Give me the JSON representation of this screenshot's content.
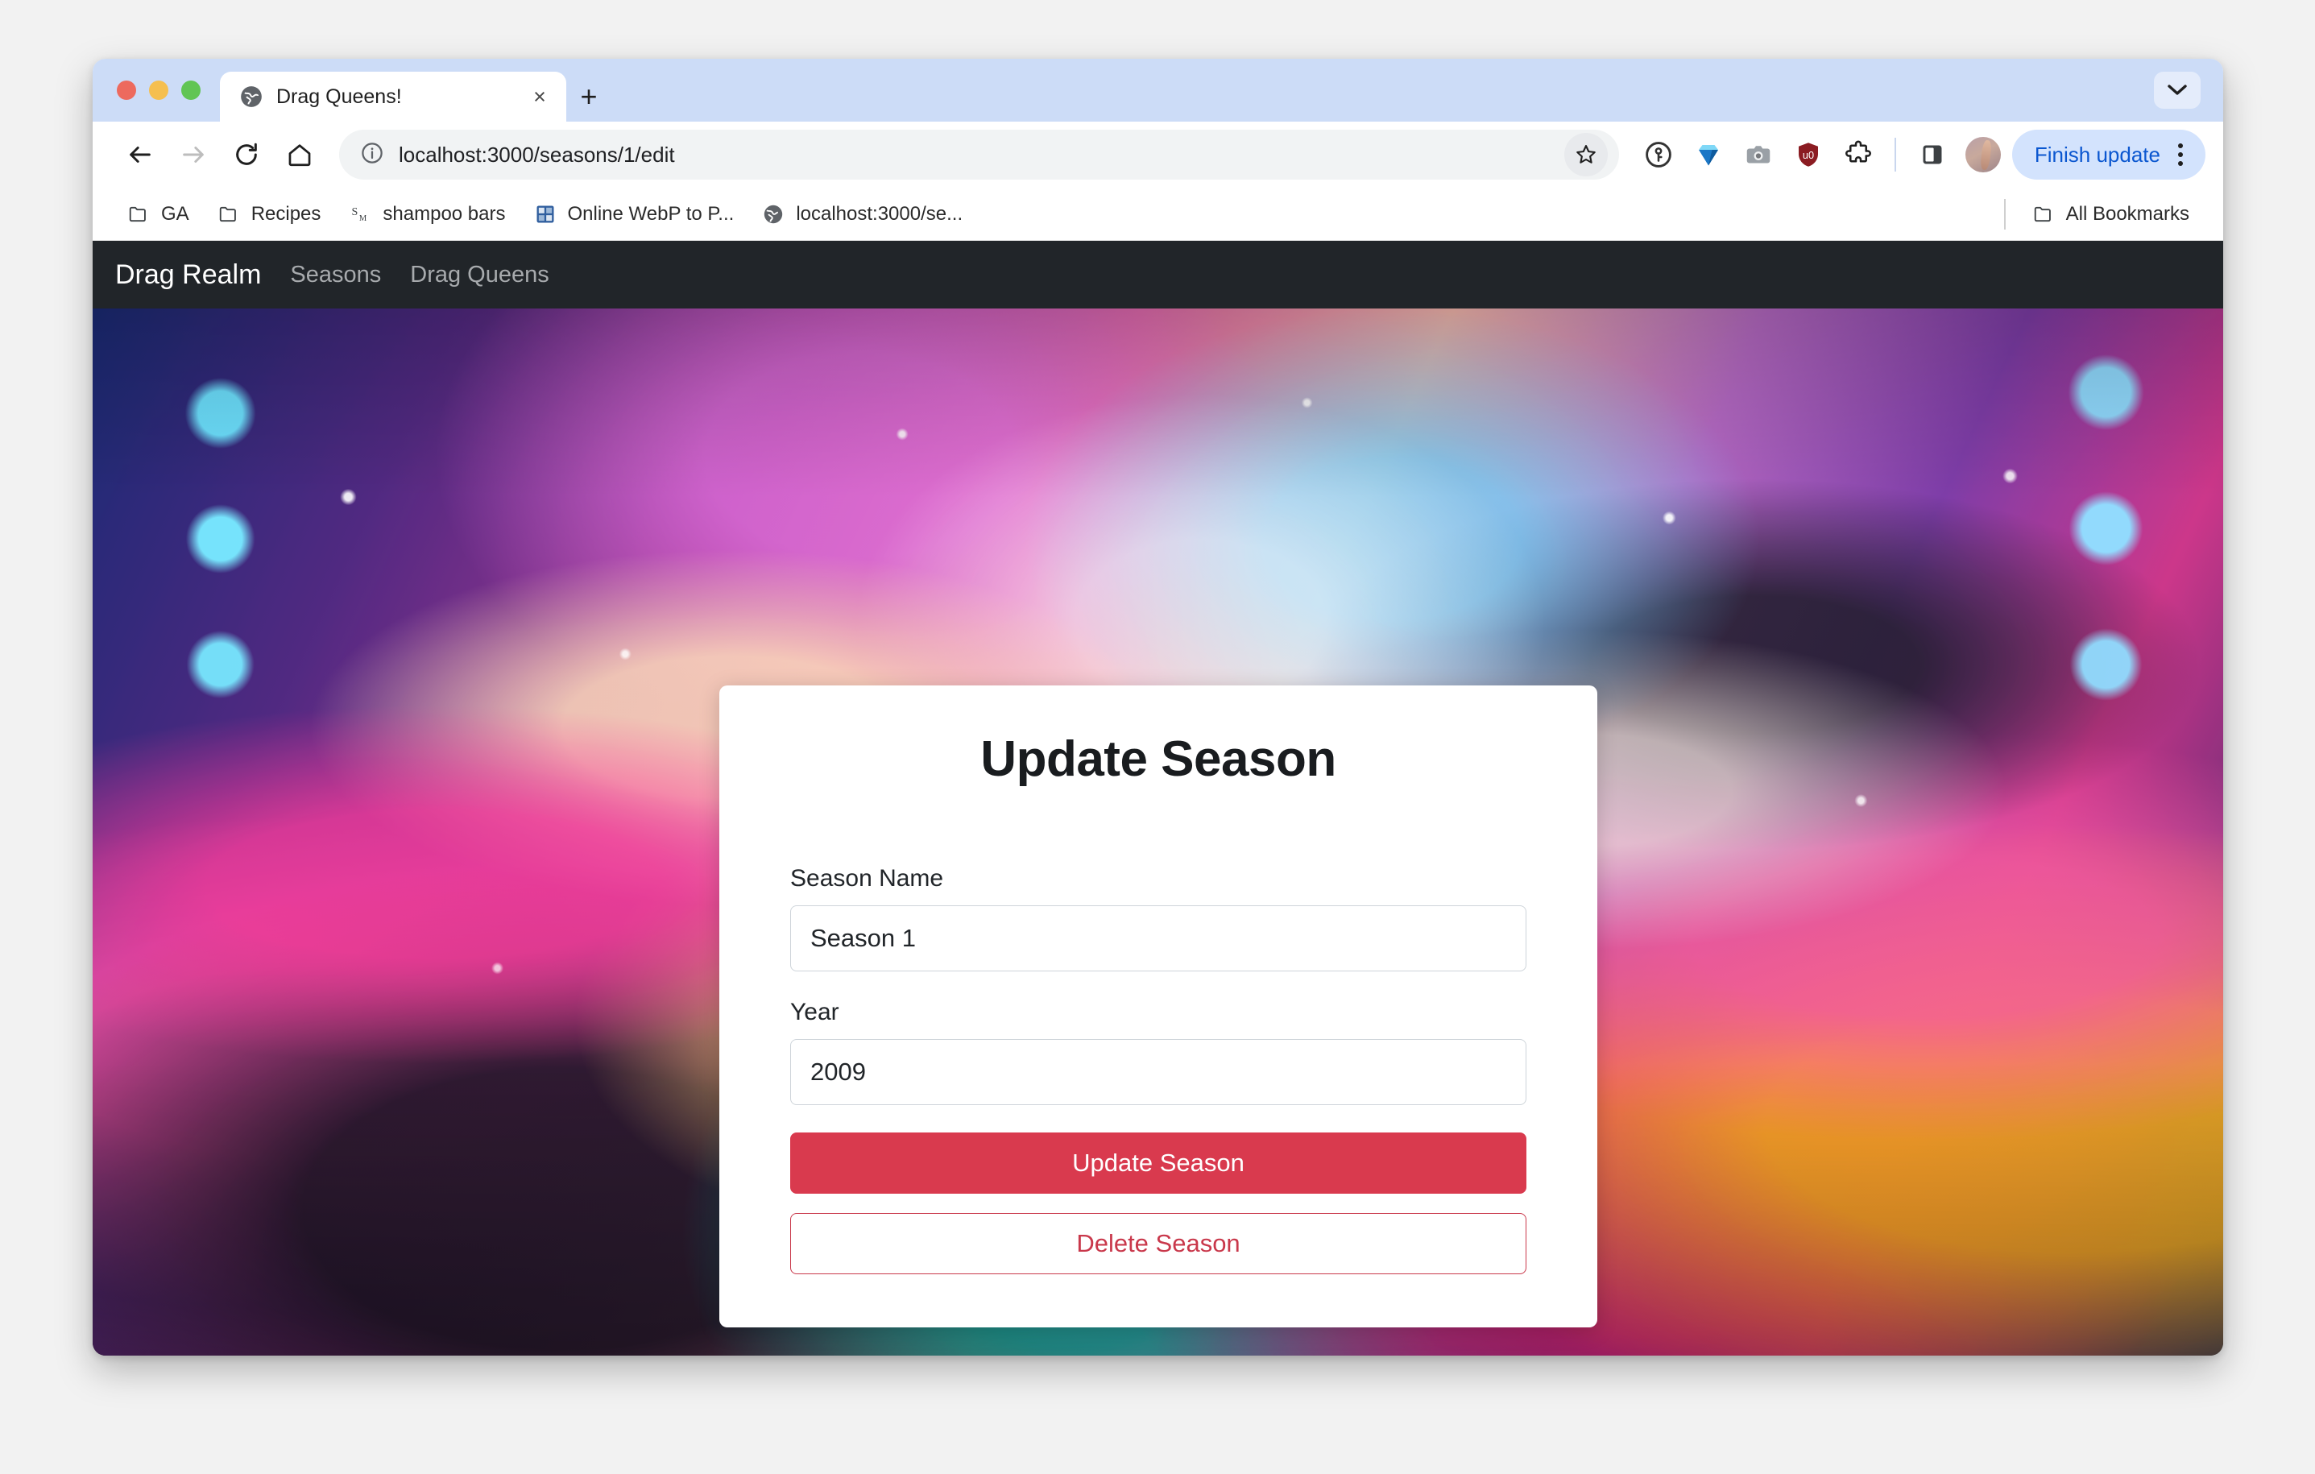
{
  "browser": {
    "tab": {
      "title": "Drag Queens!",
      "favicon": "globe-icon",
      "close_label": "×"
    },
    "new_tab_label": "+",
    "toolbar": {
      "back_icon": "back-arrow-icon",
      "forward_icon": "forward-arrow-icon",
      "reload_icon": "reload-icon",
      "home_icon": "home-icon",
      "site_info_icon": "info-circle-icon",
      "url": "localhost:3000/seasons/1/edit",
      "bookmark_icon": "star-icon",
      "extensions": [
        {
          "name": "1password-icon",
          "glyph": "ⓘ"
        },
        {
          "name": "gem-icon",
          "glyph": "◆"
        },
        {
          "name": "camera-icon",
          "glyph": "▣"
        },
        {
          "name": "ublock-origin-icon",
          "glyph": "uO"
        },
        {
          "name": "puzzle-piece-icon",
          "glyph": "❖"
        }
      ],
      "side_panel_icon": "side-panel-icon",
      "avatar_icon": "profile-avatar",
      "finish_update_label": "Finish update",
      "menu_icon": "three-dot-menu-icon"
    },
    "bookmarks": [
      {
        "label": "GA",
        "icon": "folder-icon"
      },
      {
        "label": "Recipes",
        "icon": "folder-icon"
      },
      {
        "label": "shampoo bars",
        "icon": "page-icon"
      },
      {
        "label": "Online WebP to P...",
        "icon": "app-icon"
      },
      {
        "label": "localhost:3000/se...",
        "icon": "globe-icon"
      }
    ],
    "all_bookmarks": {
      "label": "All Bookmarks",
      "icon": "folder-icon"
    }
  },
  "app": {
    "brand": "Drag Realm",
    "nav_links": [
      {
        "label": "Seasons"
      },
      {
        "label": "Drag Queens"
      }
    ]
  },
  "card": {
    "title": "Update Season",
    "fields": [
      {
        "label": "Season Name",
        "value": "Season 1",
        "placeholder": "Season Name"
      },
      {
        "label": "Year",
        "value": "2009",
        "placeholder": "Year"
      }
    ],
    "primary_button": "Update Season",
    "danger_button": "Delete Season"
  },
  "colors": {
    "navbar": "#212529",
    "primary_red": "#d93a4e",
    "danger_outline": "#c9384b",
    "tab_strip": "#ccdcf7",
    "accent_blue": "#0b57d0"
  }
}
